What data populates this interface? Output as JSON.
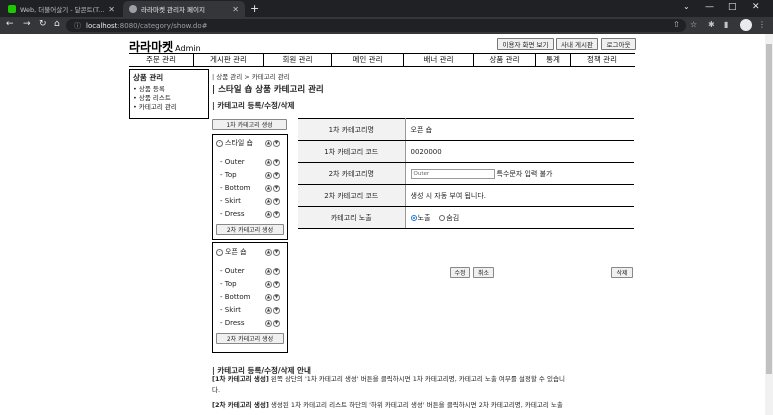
{
  "browser": {
    "tabs": [
      {
        "title": "Web, 더불어살기 - 달콘트(Talam"
      },
      {
        "title": "라라마켓 관리자 페이지"
      }
    ],
    "url_host": "localhost",
    "url_path": ":8080/category/show.do#"
  },
  "header": {
    "logo": "라라마켓",
    "logo_sub": "Admin",
    "buttons": [
      "이용자 화면 보기",
      "사내 게시판",
      "로그아웃"
    ]
  },
  "gnb": [
    "주문 관리",
    "게시판 관리",
    "회원 관리",
    "메인 관리",
    "배너 관리",
    "상품 관리",
    "통계",
    "정책 관리"
  ],
  "lnb": {
    "title": "상품 관리",
    "items": [
      "• 상품 등록",
      "• 상품 리스트",
      "• 카테고리 관리"
    ]
  },
  "breadcrumb": "| 상품 관리 > 카테고리 관리",
  "title": "| 스타일 숍 상품 카테고리 관리",
  "subtitle": "| 카테고리 등록/수정/삭제",
  "tree": {
    "add_first_btn": "1차 카테고리 생성",
    "groups": [
      {
        "name": "스타일 숍",
        "children": [
          "- Outer",
          "- Top",
          "- Bottom",
          "- Skirt",
          "- Dress"
        ],
        "add_second_btn": "2차 카테고리 생성"
      },
      {
        "name": "오픈 숍",
        "children": [
          "- Outer",
          "- Top",
          "- Bottom",
          "- Skirt",
          "- Dress"
        ],
        "add_second_btn": "2차 카테고리 생성"
      }
    ]
  },
  "form": {
    "rows": [
      {
        "label": "1차 카테고리명",
        "value": "오픈 숍"
      },
      {
        "label": "1차 카테고리 코드",
        "value": "0020000"
      },
      {
        "label": "2차 카테고리명",
        "input_placeholder": "Outer",
        "note": "특수문자 입력 불가"
      },
      {
        "label": "2차 카테고리 코드",
        "value": "생성 시 자동 부여 됩니다."
      },
      {
        "label": "카테고리 노출",
        "radio_on": "노출",
        "radio_off": "숨김"
      }
    ],
    "buttons": {
      "edit": "수정",
      "cancel": "취소",
      "delete": "삭제"
    }
  },
  "guide": {
    "title": "| 카테고리 등록/수정/삭제 안내",
    "line1_bold": "[1차 카테고리 생성]",
    "line1": " 왼쪽 상단의 '1차 카테고리 생성' 버튼을 클릭하시면 1차 카테고리명, 카테고리 노출 여부를 설정할 수 있습니",
    "line1b": "다.",
    "line2_bold": "[2차 카테고리 생성]",
    "line2": " 생성된 1차 카테고리 리스트 하단의 '하위 카테고리 생성' 버튼을 클릭하시면 2차 카테고리명, 카테고리 노출"
  }
}
